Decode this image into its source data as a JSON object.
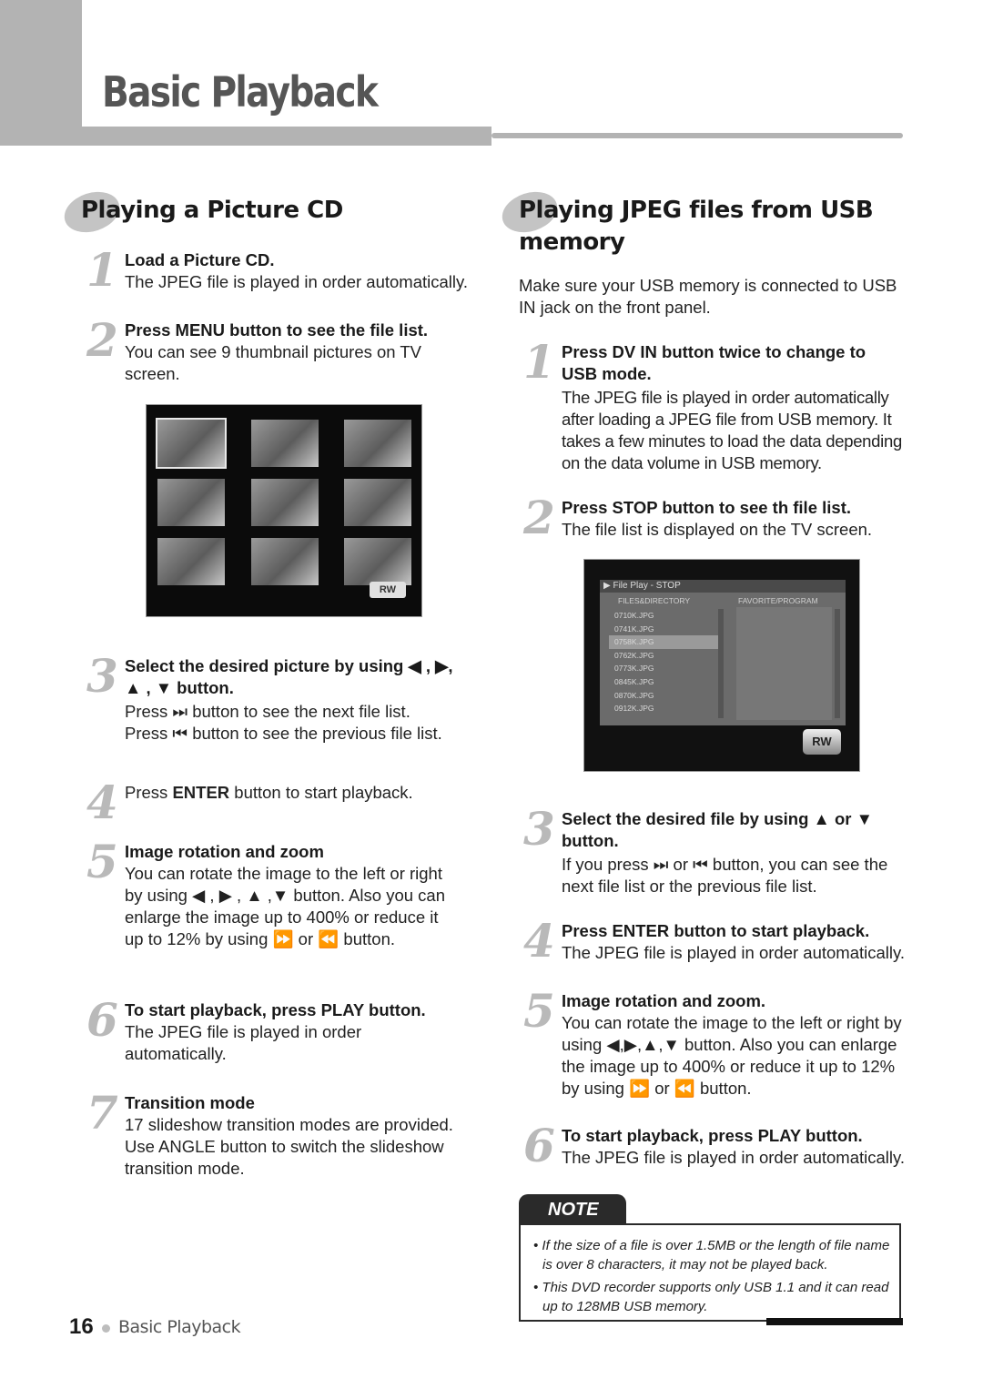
{
  "header": {
    "title": "Basic Playback"
  },
  "left": {
    "heading": "Playing a Picture CD",
    "steps": [
      {
        "num": "1",
        "title": "Load a Picture CD.",
        "text": "The JPEG file is played in order automatically."
      },
      {
        "num": "2",
        "title": "Press MENU button to see the file list.",
        "text": "You can see 9 thumbnail pictures on TV screen."
      },
      {
        "num": "3",
        "title": "Select the desired picture by using ◀ , ▶, ▲ , ▼ button.",
        "text1": "Press ⏭ button to see the next file list.",
        "text2": "Press ⏮ button to see the previous file list."
      },
      {
        "num": "4",
        "text_pre": "Press ",
        "text_bold": "ENTER",
        "text_post": " button to start playback."
      },
      {
        "num": "5",
        "title": "Image rotation and zoom",
        "text": "You can rotate the image to the left or right by using ◀ , ▶ , ▲ ,▼ button. Also you can enlarge the image up to 400% or reduce it up to 12% by using ⏩ or ⏪ button."
      },
      {
        "num": "6",
        "title": "To start playback, press PLAY button.",
        "text": "The JPEG file is played in order automatically."
      },
      {
        "num": "7",
        "title": "Transition mode",
        "text": "17 slideshow transition modes are provided. Use ANGLE button to switch the slideshow transition mode."
      }
    ],
    "thumbnail_screen": {
      "thumbnail_count": 9,
      "selected_index": 0,
      "badge": "RW"
    }
  },
  "right": {
    "heading": "Playing JPEG files from USB memory",
    "intro": "Make sure your USB memory is connected to USB IN jack on the front panel.",
    "steps": [
      {
        "num": "1",
        "title": "Press DV IN button twice to change to USB mode.",
        "text": "The JPEG file is played in order automatically after loading a JPEG file from USB memory. It takes a few minutes to load the data depending on the data volume in USB memory."
      },
      {
        "num": "2",
        "title": "Press STOP button to see th file list.",
        "text": "The file list is displayed on the TV screen."
      },
      {
        "num": "3",
        "title": "Select the desired file by using ▲ or ▼ button.",
        "text": "If you press ⏭ or ⏮ button, you can see the next file list or the previous file list."
      },
      {
        "num": "4",
        "title": "Press ENTER button to start playback.",
        "text": "The JPEG file is played in order automatically."
      },
      {
        "num": "5",
        "title": "Image rotation and zoom.",
        "text": "You can rotate the image to the left or right by using ◀,▶,▲,▼ button. Also you can enlarge the image up to 400% or reduce it up to 12% by using ⏩ or ⏪ button."
      },
      {
        "num": "6",
        "title": "To start playback, press PLAY button.",
        "text": "The JPEG file is played in order automatically."
      }
    ],
    "file_screen": {
      "title": "▶ File Play - STOP",
      "col_files": "FILES&DIRECTORY",
      "col_fav": "FAVORITE/PROGRAM",
      "files": [
        "0710K.JPG",
        "0741K.JPG",
        "0758K.JPG",
        "0762K.JPG",
        "0773K.JPG",
        "0845K.JPG",
        "0870K.JPG",
        "0912K.JPG"
      ],
      "selected_index": 2,
      "badge": "RW"
    },
    "note": {
      "label": "NOTE",
      "items": [
        "• If the size of a file is over 1.5MB or the length of file name is over 8 characters, it may not be played back.",
        "• This DVD recorder supports only USB 1.1 and it can read up to 128MB USB memory."
      ]
    }
  },
  "footer": {
    "page_number": "16",
    "section": "Basic Playback"
  }
}
